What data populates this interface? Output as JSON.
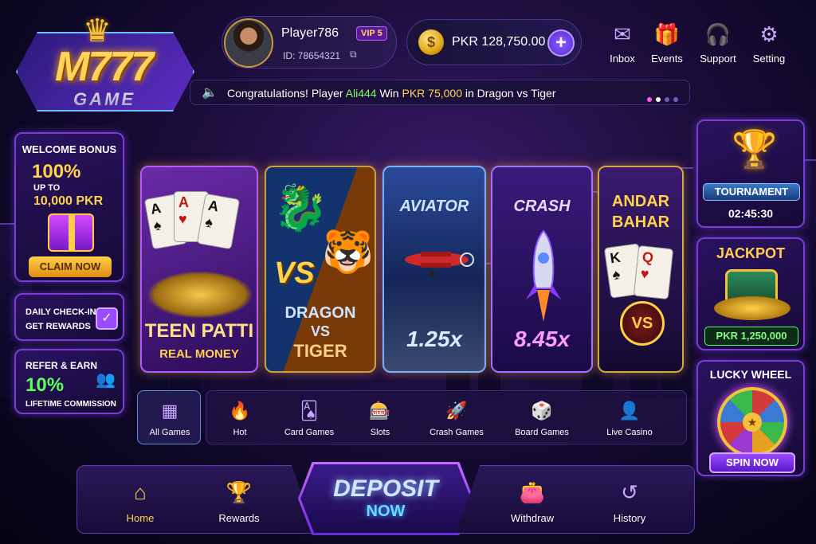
{
  "logo": {
    "brand": "M777",
    "sub": "GAME"
  },
  "profile": {
    "name": "Player786",
    "vip": "VIP 5",
    "id": "ID: 78654321"
  },
  "balance": {
    "amount": "PKR 128,750.00"
  },
  "topnav": [
    {
      "label": "Inbox",
      "icon": "mail-icon"
    },
    {
      "label": "Events",
      "icon": "gift-icon"
    },
    {
      "label": "Support",
      "icon": "headset-icon"
    },
    {
      "label": "Setting",
      "icon": "gear-icon"
    }
  ],
  "ticker": {
    "prefix": "Congratulations! Player",
    "player": "Ali444",
    "win": "Win",
    "amount": "PKR 75,000",
    "suffix": "in Dragon vs Tiger"
  },
  "welcome": {
    "title": "WELCOME BONUS",
    "percent": "100%",
    "upto": "UP TO",
    "amount": "10,000 PKR",
    "button": "CLAIM NOW"
  },
  "checkin": {
    "line1": "DAILY CHECK-IN",
    "line2": "GET REWARDS"
  },
  "refer": {
    "title": "REFER & EARN",
    "percent": "10%",
    "sub": "LIFETIME COMMISSION"
  },
  "games": {
    "teen": {
      "title": "TEEN PATTI",
      "sub": "REAL MONEY"
    },
    "dragon": {
      "vs": "VS",
      "line1": "DRAGON",
      "line2": "VS",
      "line3": "TIGER"
    },
    "aviator": {
      "title": "AVIATOR",
      "mult": "1.25x"
    },
    "crash": {
      "title": "CRASH",
      "mult": "8.45x"
    },
    "andar": {
      "line1": "ANDAR",
      "line2": "BAHAR",
      "vs": "VS"
    }
  },
  "tournament": {
    "label": "TOURNAMENT",
    "time": "02:45:30"
  },
  "jackpot": {
    "label": "JACKPOT",
    "amount": "PKR 1,250,000"
  },
  "wheel": {
    "label": "LUCKY WHEEL",
    "button": "SPIN NOW"
  },
  "categories": [
    {
      "label": "All Games",
      "icon": "grid-icon",
      "active": true
    },
    {
      "label": "Hot",
      "icon": "fire-icon"
    },
    {
      "label": "Card Games",
      "icon": "cards-icon"
    },
    {
      "label": "Slots",
      "icon": "slot-icon"
    },
    {
      "label": "Crash Games",
      "icon": "rocket-icon"
    },
    {
      "label": "Board Games",
      "icon": "dice-icon"
    },
    {
      "label": "Live Casino",
      "icon": "dealer-icon"
    }
  ],
  "bottomnav": {
    "home": "Home",
    "rewards": "Rewards",
    "deposit1": "DEPOSIT",
    "deposit2": "NOW",
    "withdraw": "Withdraw",
    "history": "History"
  },
  "colors": {
    "accent": "#7a3cd6",
    "gold": "#ffd24a",
    "green": "#7dff5a"
  }
}
